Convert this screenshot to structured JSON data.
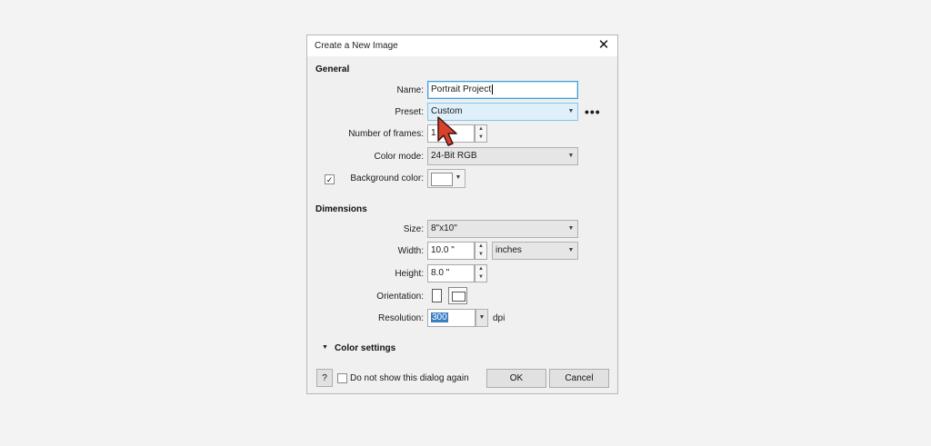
{
  "dialog": {
    "title": "Create a New Image",
    "close_icon": "close-icon"
  },
  "general": {
    "section_title": "General",
    "name_label": "Name:",
    "name_value": "Portrait Project",
    "preset_label": "Preset:",
    "preset_value": "Custom",
    "more_label": "•••",
    "frames_label": "Number of frames:",
    "frames_value": "1",
    "color_mode_label": "Color mode:",
    "color_mode_value": "24-Bit RGB",
    "background_checked": true,
    "background_label": "Background color:",
    "background_color": "#ffffff"
  },
  "dimensions": {
    "section_title": "Dimensions",
    "size_label": "Size:",
    "size_value": "8\"x10\"",
    "width_label": "Width:",
    "width_value": "10.0 \"",
    "units_value": "inches",
    "height_label": "Height:",
    "height_value": "8.0 \"",
    "orientation_label": "Orientation:",
    "resolution_label": "Resolution:",
    "resolution_value": "300",
    "resolution_unit": "dpi"
  },
  "color_settings": {
    "label": "Color settings"
  },
  "footer": {
    "help_label": "?",
    "dont_show_label": "Do not show this dialog again",
    "ok_label": "OK",
    "cancel_label": "Cancel"
  },
  "colors": {
    "focus_border": "#3aa0d8",
    "selection": "#3d7fc4",
    "cursor": "#d9412c"
  }
}
